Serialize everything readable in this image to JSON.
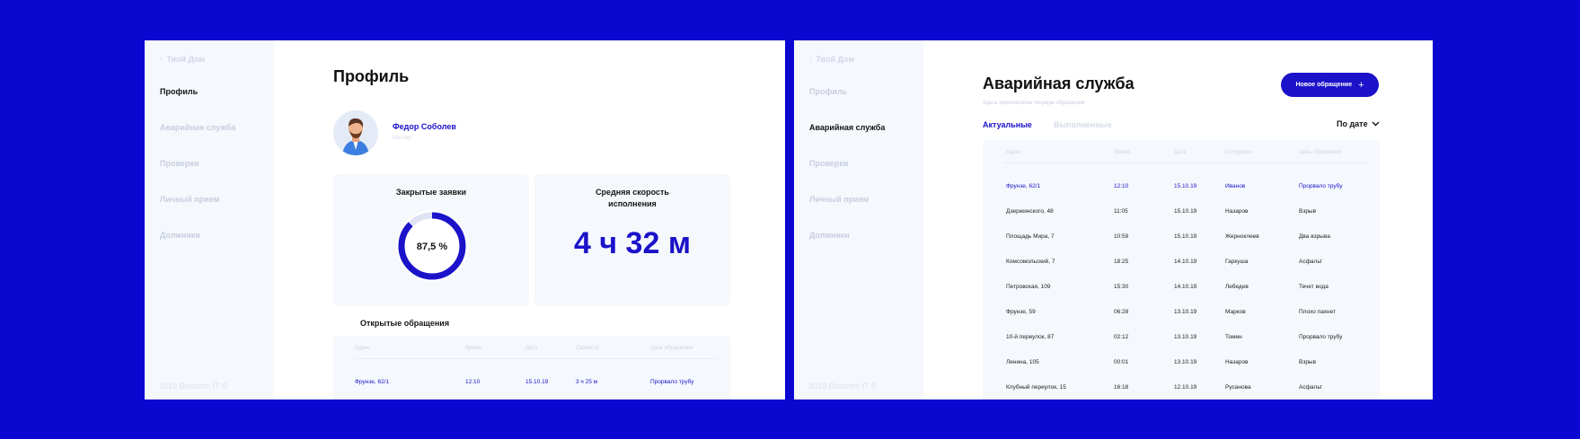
{
  "profile_screen": {
    "logo": "Твой Дом",
    "nav": [
      "Профиль",
      "Аварийная служба",
      "Проверки",
      "Личный прием",
      "Должники"
    ],
    "active_nav": 0,
    "copyright": "2019 Blossom IT ©",
    "title": "Профиль",
    "user": {
      "name": "Федор Соболев",
      "role": "Мастер"
    },
    "closed_card": {
      "title": "Закрытые заявки",
      "value": "87,5 %",
      "fraction": 0.875
    },
    "speed_card": {
      "title_line1": "Средняя скорость",
      "title_line2": "исполнения",
      "value": "4 ч 32 м"
    },
    "open_requests": {
      "title": "Открытые обращения",
      "headers": [
        "Адрес",
        "Время",
        "Дата",
        "Скорость",
        "Цель обращения"
      ],
      "rows": [
        [
          "Фрунзе, 62/1",
          "12:10",
          "15.10.19",
          "3 ч 25 м",
          "Прорвало трубу"
        ]
      ]
    }
  },
  "emergency_screen": {
    "logo": "Твой Дом",
    "nav": [
      "Профиль",
      "Аварийная служба",
      "Проверки",
      "Личный прием",
      "Должники"
    ],
    "active_nav": 1,
    "copyright": "2019 Blossom IT ©",
    "title": "Аварийная служба",
    "subtitle": "Здесь перечислены текущие обращения",
    "new_button": "Новое обращение",
    "tabs": [
      "Актуальные",
      "Выполненные"
    ],
    "sort_label": "По дате",
    "table": {
      "headers": [
        "Адрес",
        "Время",
        "Дата",
        "Сотрудник",
        "Цель обращения"
      ],
      "rows": [
        [
          "Фрунзе, 62/1",
          "12:10",
          "15.10.19",
          "Иванов",
          "Прорвало трубу"
        ],
        [
          "Дзержинского, 48",
          "11:05",
          "15.10.19",
          "Назаров",
          "Взрыв"
        ],
        [
          "Площадь Мира, 7",
          "10:59",
          "15.10.19",
          "Жерноклеев",
          "Два взрыва"
        ],
        [
          "Комсомольский, 7",
          "18:25",
          "14.10.19",
          "Гаркуша",
          "Асфальт"
        ],
        [
          "Петровская, 109",
          "15:30",
          "14.10.19",
          "Лебедев",
          "Течет вода"
        ],
        [
          "Фрунзе, 59",
          "06:28",
          "13.10.19",
          "Марков",
          "Плохо пахнет"
        ],
        [
          "10-й переулок, 87",
          "02:12",
          "13.10.19",
          "Томин",
          "Прорвало трубу"
        ],
        [
          "Ленина, 105",
          "00:01",
          "13.10.19",
          "Назаров",
          "Взрыв"
        ],
        [
          "Клубный переулок, 15",
          "16:18",
          "12.10.19",
          "Русанова",
          "Асфальт"
        ]
      ]
    }
  },
  "colors": {
    "accent": "#1b12c9",
    "background": "#0a07d1",
    "card": "#f5f8fc"
  }
}
